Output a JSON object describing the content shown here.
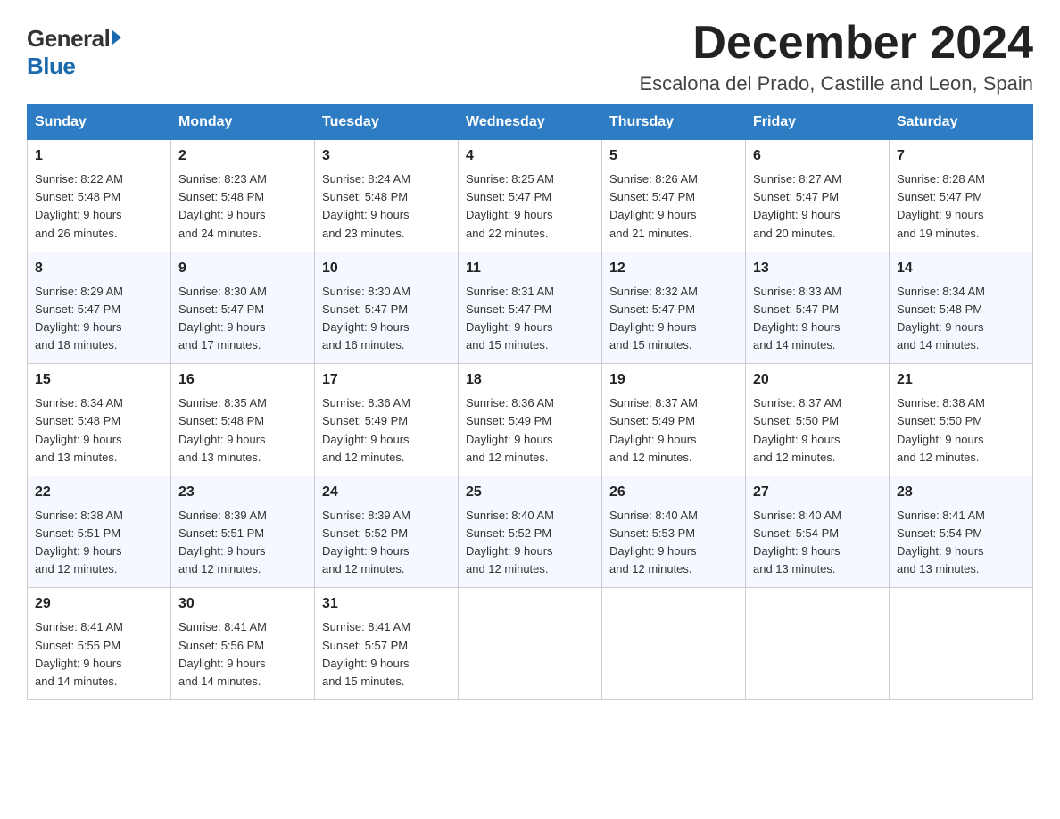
{
  "logo": {
    "general": "General",
    "blue": "Blue"
  },
  "title": {
    "month": "December 2024",
    "location": "Escalona del Prado, Castille and Leon, Spain"
  },
  "headers": [
    "Sunday",
    "Monday",
    "Tuesday",
    "Wednesday",
    "Thursday",
    "Friday",
    "Saturday"
  ],
  "weeks": [
    [
      {
        "day": "1",
        "sunrise": "8:22 AM",
        "sunset": "5:48 PM",
        "daylight": "9 hours and 26 minutes."
      },
      {
        "day": "2",
        "sunrise": "8:23 AM",
        "sunset": "5:48 PM",
        "daylight": "9 hours and 24 minutes."
      },
      {
        "day": "3",
        "sunrise": "8:24 AM",
        "sunset": "5:48 PM",
        "daylight": "9 hours and 23 minutes."
      },
      {
        "day": "4",
        "sunrise": "8:25 AM",
        "sunset": "5:47 PM",
        "daylight": "9 hours and 22 minutes."
      },
      {
        "day": "5",
        "sunrise": "8:26 AM",
        "sunset": "5:47 PM",
        "daylight": "9 hours and 21 minutes."
      },
      {
        "day": "6",
        "sunrise": "8:27 AM",
        "sunset": "5:47 PM",
        "daylight": "9 hours and 20 minutes."
      },
      {
        "day": "7",
        "sunrise": "8:28 AM",
        "sunset": "5:47 PM",
        "daylight": "9 hours and 19 minutes."
      }
    ],
    [
      {
        "day": "8",
        "sunrise": "8:29 AM",
        "sunset": "5:47 PM",
        "daylight": "9 hours and 18 minutes."
      },
      {
        "day": "9",
        "sunrise": "8:30 AM",
        "sunset": "5:47 PM",
        "daylight": "9 hours and 17 minutes."
      },
      {
        "day": "10",
        "sunrise": "8:30 AM",
        "sunset": "5:47 PM",
        "daylight": "9 hours and 16 minutes."
      },
      {
        "day": "11",
        "sunrise": "8:31 AM",
        "sunset": "5:47 PM",
        "daylight": "9 hours and 15 minutes."
      },
      {
        "day": "12",
        "sunrise": "8:32 AM",
        "sunset": "5:47 PM",
        "daylight": "9 hours and 15 minutes."
      },
      {
        "day": "13",
        "sunrise": "8:33 AM",
        "sunset": "5:47 PM",
        "daylight": "9 hours and 14 minutes."
      },
      {
        "day": "14",
        "sunrise": "8:34 AM",
        "sunset": "5:48 PM",
        "daylight": "9 hours and 14 minutes."
      }
    ],
    [
      {
        "day": "15",
        "sunrise": "8:34 AM",
        "sunset": "5:48 PM",
        "daylight": "9 hours and 13 minutes."
      },
      {
        "day": "16",
        "sunrise": "8:35 AM",
        "sunset": "5:48 PM",
        "daylight": "9 hours and 13 minutes."
      },
      {
        "day": "17",
        "sunrise": "8:36 AM",
        "sunset": "5:49 PM",
        "daylight": "9 hours and 12 minutes."
      },
      {
        "day": "18",
        "sunrise": "8:36 AM",
        "sunset": "5:49 PM",
        "daylight": "9 hours and 12 minutes."
      },
      {
        "day": "19",
        "sunrise": "8:37 AM",
        "sunset": "5:49 PM",
        "daylight": "9 hours and 12 minutes."
      },
      {
        "day": "20",
        "sunrise": "8:37 AM",
        "sunset": "5:50 PM",
        "daylight": "9 hours and 12 minutes."
      },
      {
        "day": "21",
        "sunrise": "8:38 AM",
        "sunset": "5:50 PM",
        "daylight": "9 hours and 12 minutes."
      }
    ],
    [
      {
        "day": "22",
        "sunrise": "8:38 AM",
        "sunset": "5:51 PM",
        "daylight": "9 hours and 12 minutes."
      },
      {
        "day": "23",
        "sunrise": "8:39 AM",
        "sunset": "5:51 PM",
        "daylight": "9 hours and 12 minutes."
      },
      {
        "day": "24",
        "sunrise": "8:39 AM",
        "sunset": "5:52 PM",
        "daylight": "9 hours and 12 minutes."
      },
      {
        "day": "25",
        "sunrise": "8:40 AM",
        "sunset": "5:52 PM",
        "daylight": "9 hours and 12 minutes."
      },
      {
        "day": "26",
        "sunrise": "8:40 AM",
        "sunset": "5:53 PM",
        "daylight": "9 hours and 12 minutes."
      },
      {
        "day": "27",
        "sunrise": "8:40 AM",
        "sunset": "5:54 PM",
        "daylight": "9 hours and 13 minutes."
      },
      {
        "day": "28",
        "sunrise": "8:41 AM",
        "sunset": "5:54 PM",
        "daylight": "9 hours and 13 minutes."
      }
    ],
    [
      {
        "day": "29",
        "sunrise": "8:41 AM",
        "sunset": "5:55 PM",
        "daylight": "9 hours and 14 minutes."
      },
      {
        "day": "30",
        "sunrise": "8:41 AM",
        "sunset": "5:56 PM",
        "daylight": "9 hours and 14 minutes."
      },
      {
        "day": "31",
        "sunrise": "8:41 AM",
        "sunset": "5:57 PM",
        "daylight": "9 hours and 15 minutes."
      },
      null,
      null,
      null,
      null
    ]
  ],
  "labels": {
    "sunrise": "Sunrise:",
    "sunset": "Sunset:",
    "daylight": "Daylight:"
  }
}
